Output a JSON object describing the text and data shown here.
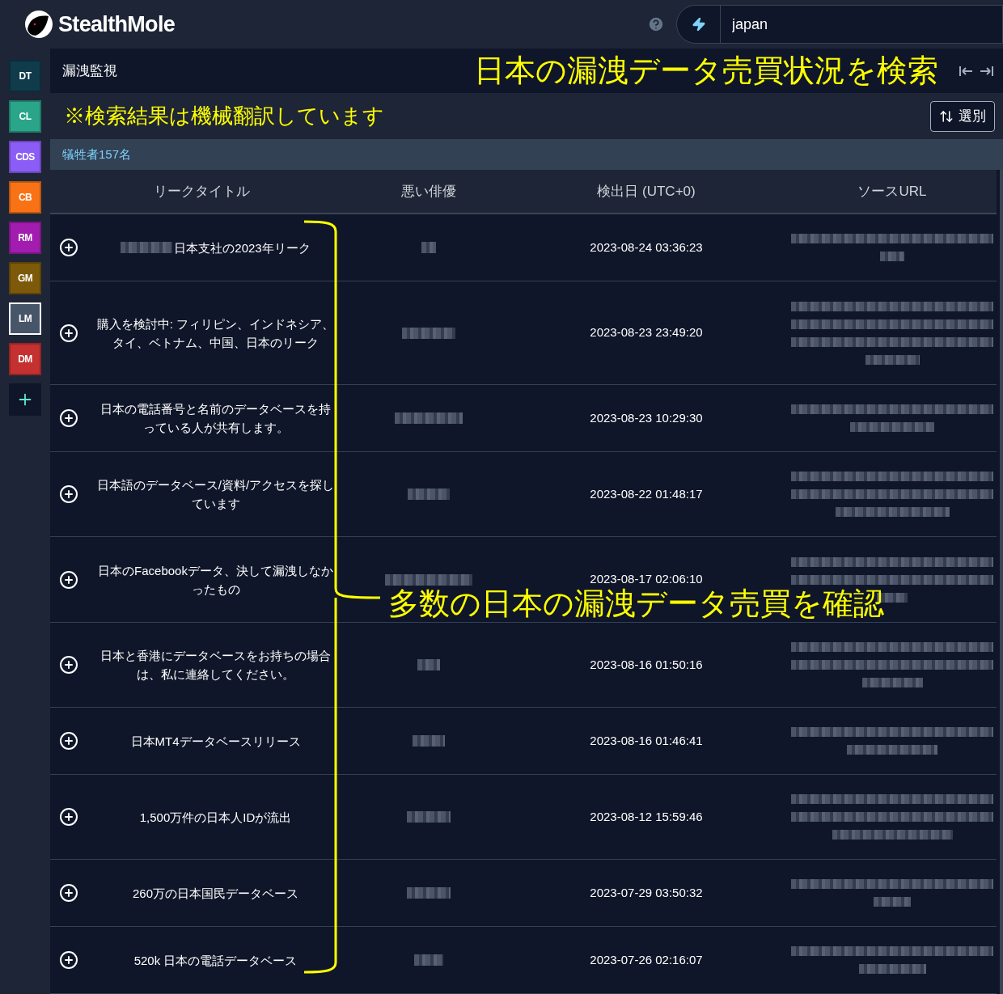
{
  "header": {
    "brand": "StealthMole",
    "search": {
      "value": "japan"
    }
  },
  "sidebar": {
    "items": [
      {
        "label": "DT",
        "color": "#0f3b4b",
        "selected": false
      },
      {
        "label": "CL",
        "color": "#2aa58a",
        "selected": false
      },
      {
        "label": "CDS",
        "color": "#8b5cf6",
        "selected": false
      },
      {
        "label": "CB",
        "color": "#f97316",
        "selected": false
      },
      {
        "label": "RM",
        "color": "#a21caf",
        "selected": false
      },
      {
        "label": "GM",
        "color": "#7c5a0a",
        "selected": false
      },
      {
        "label": "LM",
        "color": "#475569",
        "selected": true
      },
      {
        "label": "DM",
        "color": "#c53030",
        "selected": false
      }
    ]
  },
  "page_title": "漏洩監視",
  "sort_button": "選別",
  "victim_count": "犠牲者157名",
  "table": {
    "columns": [
      "リークタイトル",
      "悪い俳優",
      "検出日 (UTC+0)",
      "ソースURL"
    ],
    "rows": [
      {
        "title": "日本支社の2023年リーク",
        "redacted_prefix": true,
        "date": "2023-08-24 03:36:23"
      },
      {
        "title": "購入を検討中: フィリピン、インドネシア、タイ、ベトナム、中国、日本のリーク",
        "redacted_prefix": false,
        "date": "2023-08-23 23:49:20"
      },
      {
        "title": "日本の電話番号と名前のデータベースを持っている人が共有します。",
        "redacted_prefix": false,
        "date": "2023-08-23 10:29:30"
      },
      {
        "title": "日本語のデータベース/資料/アクセスを探しています",
        "redacted_prefix": false,
        "date": "2023-08-22 01:48:17"
      },
      {
        "title": "日本のFacebookデータ、決して漏洩しなかったもの",
        "redacted_prefix": false,
        "date": "2023-08-17 02:06:10"
      },
      {
        "title": "日本と香港にデータベースをお持ちの場合は、私に連絡してください。",
        "redacted_prefix": false,
        "date": "2023-08-16 01:50:16"
      },
      {
        "title": "日本MT4データベースリリース",
        "redacted_prefix": false,
        "date": "2023-08-16 01:46:41"
      },
      {
        "title": "1,500万件の日本人IDが流出",
        "redacted_prefix": false,
        "date": "2023-08-12 15:59:46"
      },
      {
        "title": "260万の日本国民データベース",
        "redacted_prefix": false,
        "date": "2023-07-29 03:50:32"
      },
      {
        "title": "520k 日本の電話データベース",
        "redacted_prefix": false,
        "date": "2023-07-26 02:16:07"
      }
    ]
  },
  "annotations": {
    "headline": "日本の漏洩データ売買状況を検索",
    "note": "※検索結果は機械翻訳しています",
    "callout": "多数の日本の漏洩データ売買を確認"
  }
}
